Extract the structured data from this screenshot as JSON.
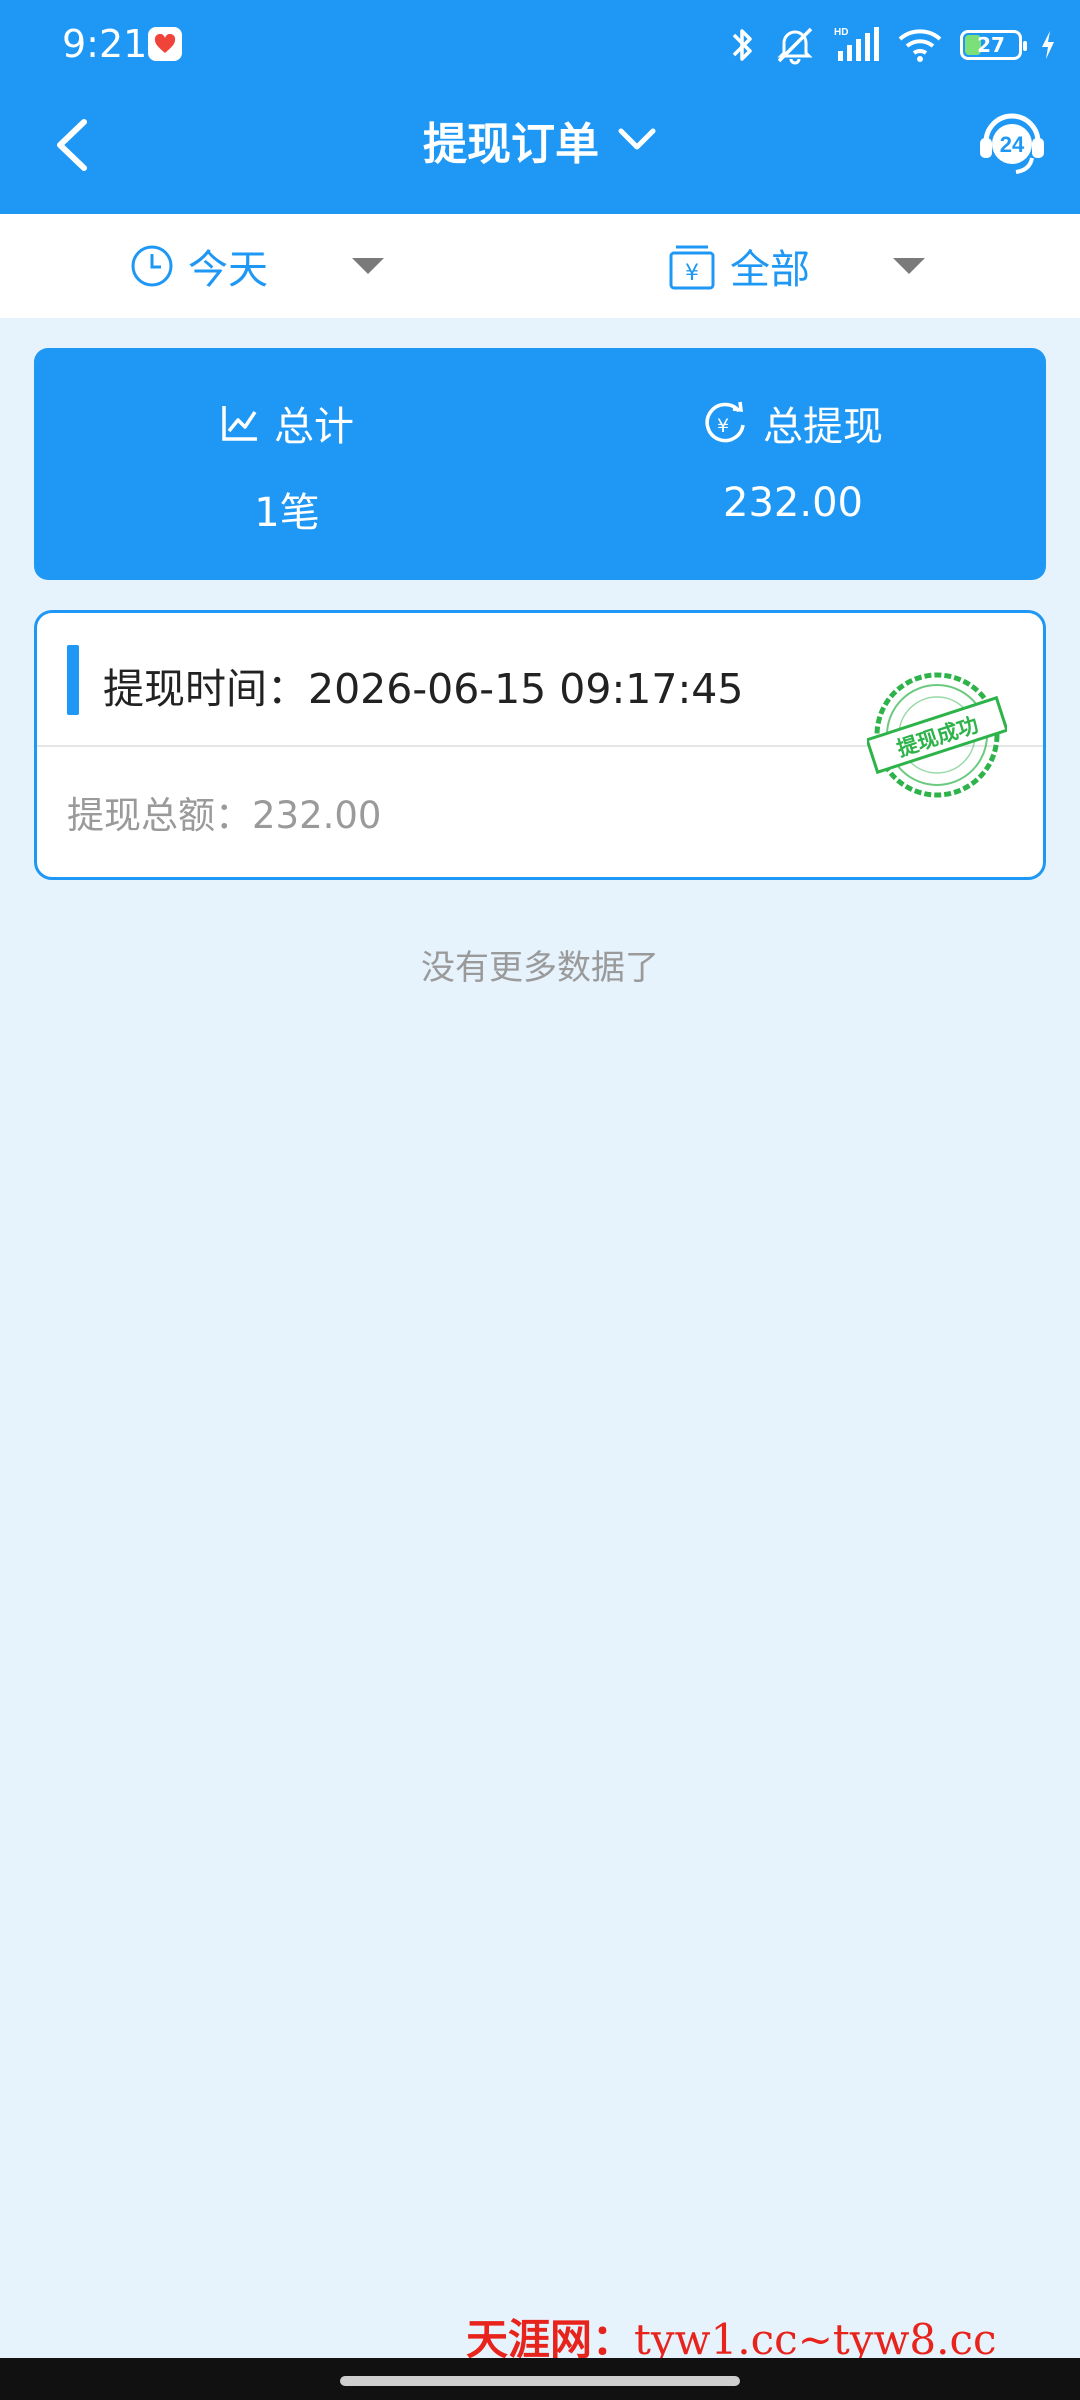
{
  "status_bar": {
    "time": "9:21",
    "battery": "27"
  },
  "header": {
    "title": "提现订单"
  },
  "filters": {
    "date": "今天",
    "type": "全部"
  },
  "summary": {
    "total_label": "总计",
    "total_value": "1笔",
    "withdraw_label": "总提现",
    "withdraw_value": "232.00"
  },
  "orders": [
    {
      "time_label": "提现时间：2026-06-15 09:17:45",
      "amount_label": "提现总额：232.00",
      "stamp": "提现成功"
    }
  ],
  "list_footer": "没有更多数据了",
  "watermark": {
    "brand": "天涯网：",
    "urls": "tyw1.cc~tyw8.cc"
  },
  "colors": {
    "primary": "#1e98f4",
    "background": "#e6f2fc",
    "stamp": "#2db34a",
    "watermark": "#e8231c"
  },
  "icons": [
    "back-icon",
    "chevron-down-icon",
    "support-24-icon",
    "clock-icon",
    "yuan-wallet-icon",
    "trend-chart-icon",
    "yuan-refresh-icon",
    "success-stamp"
  ]
}
